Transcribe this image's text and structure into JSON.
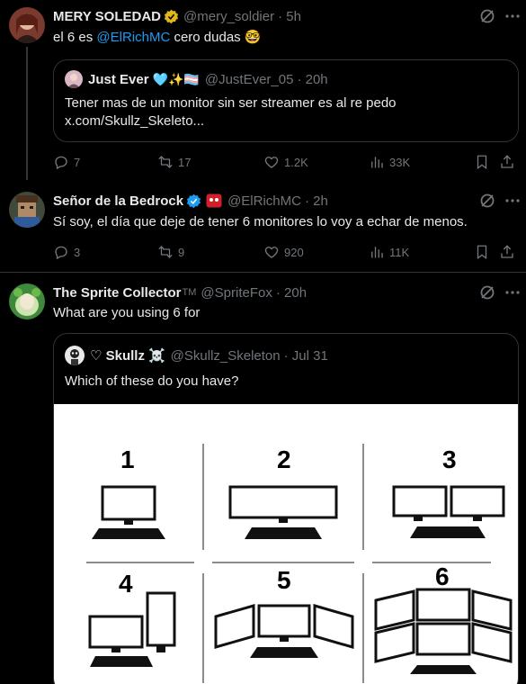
{
  "tweet1": {
    "name": "MERY SOLEDAD",
    "handle": "@mery_soldier",
    "time": "· 5h",
    "text_prefix": "el 6 es ",
    "mention": "@ElRichMC",
    "text_suffix": " cero dudas",
    "emoji": "🤓",
    "quote": {
      "name": "Just Ever",
      "emojis": "🩵✨🏳️‍⚧️",
      "handle": "@JustEver_05",
      "time": "· 20h",
      "text": "Tener mas de un monitor sin ser streamer es al re pedo x.com/Skullz_Skeleto..."
    },
    "replies": "7",
    "retweets": "17",
    "likes": "1.2K",
    "views": "33K"
  },
  "tweet2": {
    "name": "Señor de la Bedrock",
    "handle": "@ElRichMC",
    "time": "· 2h",
    "text": "Sí soy, el día que deje de tener 6 monitores lo voy a echar de menos.",
    "replies": "3",
    "retweets": "9",
    "likes": "920",
    "views": "11K"
  },
  "tweet3": {
    "name": "The Sprite Collector",
    "tm": "TM",
    "handle": "@SpriteFox",
    "time": "· 20h",
    "text": "What are you using 6 for",
    "quote": {
      "name": "♡ Skullz",
      "emoji": "☠️",
      "handle": "@Skullz_Skeleton",
      "time": "· Jul 31",
      "text": "Which of these do you have?",
      "image_labels": [
        "1",
        "2",
        "3",
        "4",
        "5",
        "6"
      ]
    }
  },
  "colors": {
    "bg": "#000000",
    "text": "#e7e9ea",
    "muted": "#71767b",
    "link": "#1d9bf0",
    "border": "#2f3336"
  }
}
